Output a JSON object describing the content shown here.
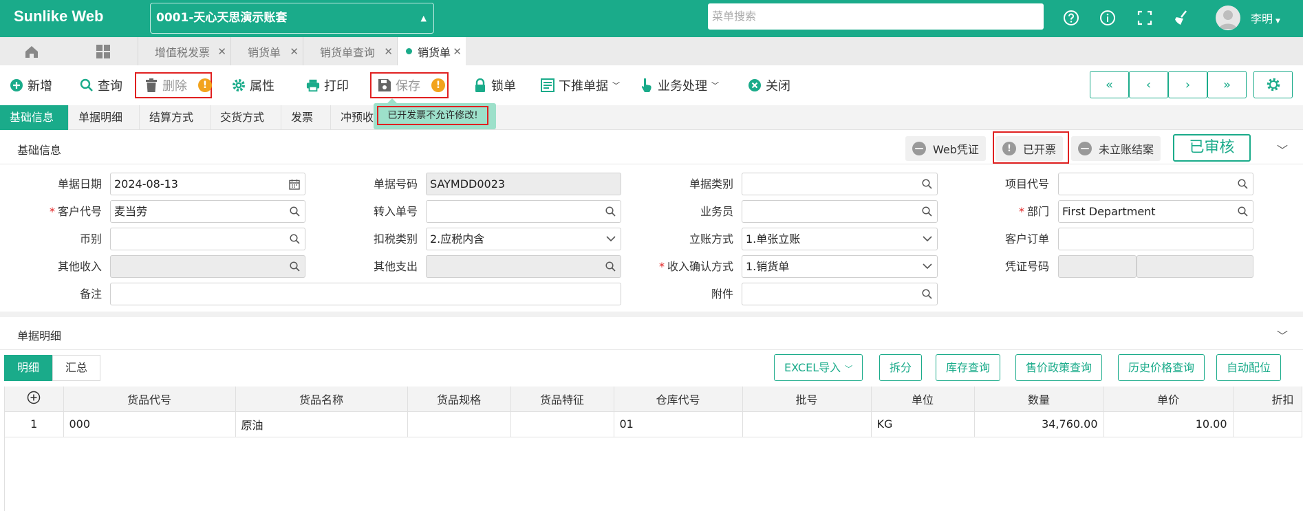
{
  "header": {
    "logo": "Sunlike Web",
    "account": "0001-天心天思演示账套",
    "search_placeholder": "菜单搜索",
    "username": "李明",
    "icons": [
      "help-icon",
      "info-icon",
      "fullscreen-icon",
      "clean-icon",
      "user-avatar"
    ]
  },
  "tabs": [
    {
      "label": "增值税发票"
    },
    {
      "label": "销货单"
    },
    {
      "label": "销货单查询"
    },
    {
      "label": "销货单",
      "active": true
    }
  ],
  "toolbar": {
    "add": "新增",
    "query": "查询",
    "delete": "删除",
    "properties": "属性",
    "print": "打印",
    "save": "保存",
    "lock": "锁单",
    "push_down": "下推单据",
    "business": "业务处理",
    "close": "关闭",
    "warn_mark": "!"
  },
  "section_tabs": [
    "基础信息",
    "单据明细",
    "结算方式",
    "交货方式",
    "发票",
    "冲预收"
  ],
  "tooltip": "已开发票不允许修改!",
  "basic": {
    "title": "基础信息",
    "status_web": "Web凭证",
    "status_invoiced": "已开票",
    "status_unclosed": "未立账结案",
    "approved": "已审核",
    "fields": {
      "doc_date_label": "单据日期",
      "doc_date": "2024-08-13",
      "doc_no_label": "单据号码",
      "doc_no": "SAYMDD0023",
      "doc_type_label": "单据类别",
      "doc_type": "",
      "project_label": "项目代号",
      "project": "",
      "customer_label": "客户代号",
      "customer": "麦当劳",
      "transfer_label": "转入单号",
      "transfer": "",
      "salesman_label": "业务员",
      "salesman": "",
      "dept_label": "部门",
      "dept": "First Department",
      "currency_label": "币别",
      "currency": "",
      "tax_label": "扣税类别",
      "tax": "2.应税内含",
      "account_label": "立账方式",
      "account": "1.单张立账",
      "cust_order_label": "客户订单",
      "cust_order": "",
      "other_income_label": "其他收入",
      "other_income": "",
      "other_expense_label": "其他支出",
      "other_expense": "",
      "income_confirm_label": "收入确认方式",
      "income_confirm": "1.销货单",
      "voucher_label": "凭证号码",
      "voucher": "",
      "remark_label": "备注",
      "remark": "",
      "attachment_label": "附件",
      "attachment": ""
    }
  },
  "detail": {
    "title": "单据明细",
    "subtabs": [
      "明细",
      "汇总"
    ],
    "buttons": {
      "excel": "EXCEL导入",
      "split": "拆分",
      "stock": "库存查询",
      "price_policy": "售价政策查询",
      "history": "历史价格查询",
      "auto_alloc": "自动配位"
    },
    "columns": [
      "货品代号",
      "货品名称",
      "货品规格",
      "货品特征",
      "仓库代号",
      "批号",
      "单位",
      "数量",
      "单价",
      "折扣"
    ],
    "rows": [
      {
        "no": "1",
        "code": "000",
        "name": "原油",
        "spec": "",
        "feature": "",
        "wh": "01",
        "batch": "",
        "unit": "KG",
        "qty": "34,760.00",
        "price": "10.00",
        "disc": ""
      }
    ]
  },
  "colors": {
    "brand": "#1aab8a",
    "warn": "#f2a31d",
    "highlight": "#e02020"
  }
}
